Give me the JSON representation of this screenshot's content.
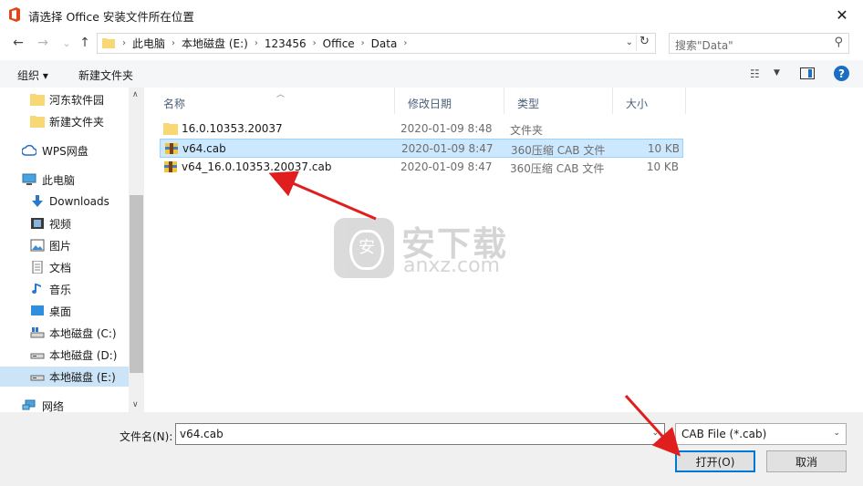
{
  "window": {
    "title": "请选择 Office 安装文件所在位置",
    "close_glyph": "✕"
  },
  "nav": {
    "back": "←",
    "forward": "→",
    "recent": "⌄",
    "up": "↑"
  },
  "address": {
    "crumbs": [
      "此电脑",
      "本地磁盘 (E:)",
      "123456",
      "Office",
      "Data"
    ],
    "refresh": "↻"
  },
  "search": {
    "placeholder": "搜索\"Data\""
  },
  "toolbar": {
    "organize": "组织 ▾",
    "new_folder": "新建文件夹"
  },
  "sidebar": {
    "items": [
      {
        "label": "河东软件园",
        "icon": "folder-icon"
      },
      {
        "label": "新建文件夹",
        "icon": "folder-icon"
      },
      {
        "label": "WPS网盘",
        "icon": "cloud-icon"
      },
      {
        "label": "此电脑",
        "icon": "computer-icon"
      },
      {
        "label": "Downloads",
        "icon": "download-icon"
      },
      {
        "label": "视频",
        "icon": "video-icon"
      },
      {
        "label": "图片",
        "icon": "picture-icon"
      },
      {
        "label": "文档",
        "icon": "document-icon"
      },
      {
        "label": "音乐",
        "icon": "music-icon"
      },
      {
        "label": "桌面",
        "icon": "desktop-icon"
      },
      {
        "label": "本地磁盘 (C:)",
        "icon": "drive-icon"
      },
      {
        "label": "本地磁盘 (D:)",
        "icon": "drive-icon"
      },
      {
        "label": "本地磁盘 (E:)",
        "icon": "drive-icon",
        "selected": true
      },
      {
        "label": "网络",
        "icon": "network-icon"
      }
    ]
  },
  "columns": {
    "name": "名称",
    "date": "修改日期",
    "type": "类型",
    "size": "大小"
  },
  "files": [
    {
      "name": "16.0.10353.20037",
      "date": "2020-01-09 8:48",
      "type": "文件夹",
      "size": "",
      "icon": "folder-icon"
    },
    {
      "name": "v64.cab",
      "date": "2020-01-09 8:47",
      "type": "360压缩 CAB 文件",
      "size": "10 KB",
      "icon": "archive-icon",
      "selected": true
    },
    {
      "name": "v64_16.0.10353.20037.cab",
      "date": "2020-01-09 8:47",
      "type": "360压缩 CAB 文件",
      "size": "10 KB",
      "icon": "archive-icon"
    }
  ],
  "watermark": {
    "cn": "安下载",
    "en": "anxz.com"
  },
  "bottom": {
    "filename_label": "文件名(N):",
    "filename_value": "v64.cab",
    "filetype_value": "CAB File (*.cab)",
    "open_label": "打开(O)",
    "cancel_label": "取消"
  },
  "colors": {
    "accent": "#0078d7",
    "selection": "#cce8ff",
    "arrow": "#e01e1e"
  }
}
